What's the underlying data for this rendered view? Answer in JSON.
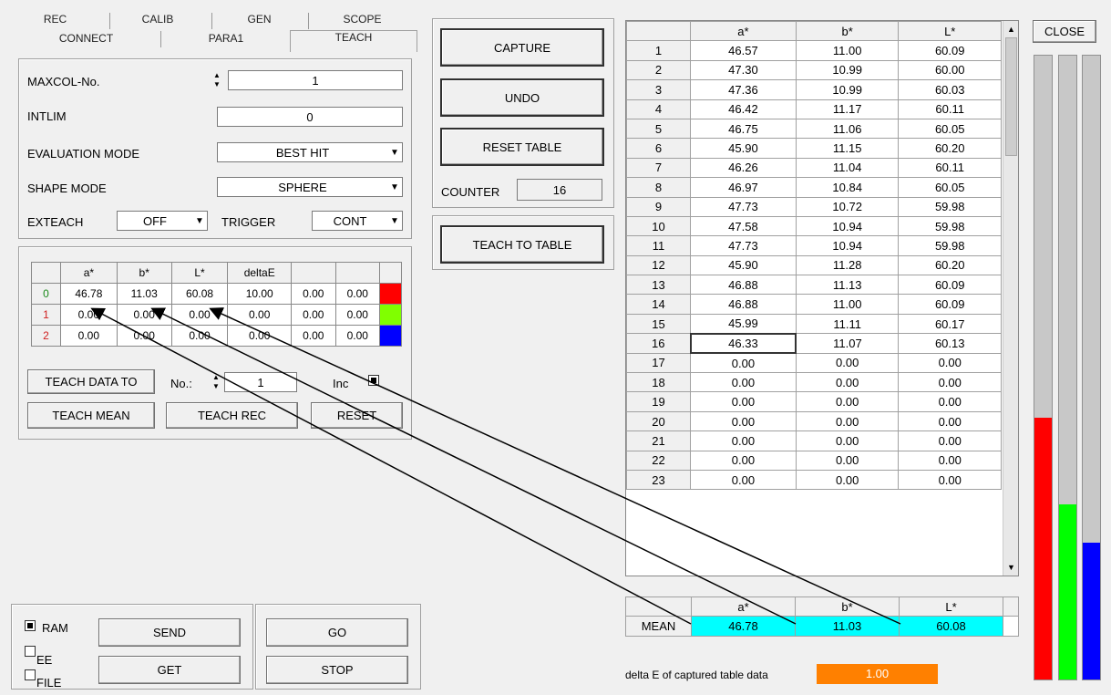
{
  "tabs_row1": [
    "REC",
    "CALIB",
    "GEN",
    "SCOPE"
  ],
  "tabs_row2": [
    "CONNECT",
    "PARA1",
    "TEACH"
  ],
  "settings": {
    "maxcol_label": "MAXCOL-No.",
    "maxcol_value": "1",
    "intlim_label": "INTLIM",
    "intlim_value": "0",
    "eval_label": "EVALUATION MODE",
    "eval_value": "BEST HIT",
    "shape_label": "SHAPE MODE",
    "shape_value": "SPHERE",
    "exteach_label": "EXTEACH",
    "exteach_value": "OFF",
    "trigger_label": "TRIGGER",
    "trigger_value": "CONT"
  },
  "teach_table": {
    "headers": [
      "a*",
      "b*",
      "L*",
      "deltaE",
      "",
      ""
    ],
    "rows": [
      {
        "idx": "0",
        "vals": [
          "46.78",
          "11.03",
          "60.08",
          "10.00",
          "0.00",
          "0.00"
        ],
        "color": "#ff0000"
      },
      {
        "idx": "1",
        "vals": [
          "0.00",
          "0.00",
          "0.00",
          "0.00",
          "0.00",
          "0.00"
        ],
        "color": "#80ff00"
      },
      {
        "idx": "2",
        "vals": [
          "0.00",
          "0.00",
          "0.00",
          "0.00",
          "0.00",
          "0.00"
        ],
        "color": "#0000ff"
      }
    ]
  },
  "teach_buttons": {
    "teach_data_to": "TEACH DATA TO",
    "no_label": "No.:",
    "no_value": "1",
    "inc_label": "Inc",
    "teach_mean": "TEACH MEAN",
    "teach_rec": "TEACH REC",
    "reset": "RESET"
  },
  "bottom": {
    "ram": "RAM",
    "ee": "EE",
    "file": "FILE",
    "send": "SEND",
    "get": "GET",
    "go": "GO",
    "stop": "STOP"
  },
  "middle": {
    "capture": "CAPTURE",
    "undo": "UNDO",
    "reset_table": "RESET TABLE",
    "counter_label": "COUNTER",
    "counter_value": "16",
    "teach_to_table": "TEACH TO TABLE"
  },
  "data_table": {
    "headers": [
      "a*",
      "b*",
      "L*"
    ],
    "rows": [
      [
        "1",
        "46.57",
        "11.00",
        "60.09"
      ],
      [
        "2",
        "47.30",
        "10.99",
        "60.00"
      ],
      [
        "3",
        "47.36",
        "10.99",
        "60.03"
      ],
      [
        "4",
        "46.42",
        "11.17",
        "60.11"
      ],
      [
        "5",
        "46.75",
        "11.06",
        "60.05"
      ],
      [
        "6",
        "45.90",
        "11.15",
        "60.20"
      ],
      [
        "7",
        "46.26",
        "11.04",
        "60.11"
      ],
      [
        "8",
        "46.97",
        "10.84",
        "60.05"
      ],
      [
        "9",
        "47.73",
        "10.72",
        "59.98"
      ],
      [
        "10",
        "47.58",
        "10.94",
        "59.98"
      ],
      [
        "11",
        "47.73",
        "10.94",
        "59.98"
      ],
      [
        "12",
        "45.90",
        "11.28",
        "60.20"
      ],
      [
        "13",
        "46.88",
        "11.13",
        "60.09"
      ],
      [
        "14",
        "46.88",
        "11.00",
        "60.09"
      ],
      [
        "15",
        "45.99",
        "11.11",
        "60.17"
      ],
      [
        "16",
        "46.33",
        "11.07",
        "60.13"
      ],
      [
        "17",
        "0.00",
        "0.00",
        "0.00"
      ],
      [
        "18",
        "0.00",
        "0.00",
        "0.00"
      ],
      [
        "19",
        "0.00",
        "0.00",
        "0.00"
      ],
      [
        "20",
        "0.00",
        "0.00",
        "0.00"
      ],
      [
        "21",
        "0.00",
        "0.00",
        "0.00"
      ],
      [
        "22",
        "0.00",
        "0.00",
        "0.00"
      ],
      [
        "23",
        "0.00",
        "0.00",
        "0.00"
      ]
    ]
  },
  "mean_table": {
    "headers": [
      "a*",
      "b*",
      "L*"
    ],
    "label": "MEAN",
    "values": [
      "46.78",
      "11.03",
      "60.08"
    ]
  },
  "delta": {
    "label": "delta E of captured table data",
    "value": "1.00"
  },
  "close": "CLOSE",
  "bars": [
    {
      "color": "#ff0000",
      "level": 0.42
    },
    {
      "color": "#00ff00",
      "level": 0.28
    },
    {
      "color": "#0000ff",
      "level": 0.22
    }
  ]
}
